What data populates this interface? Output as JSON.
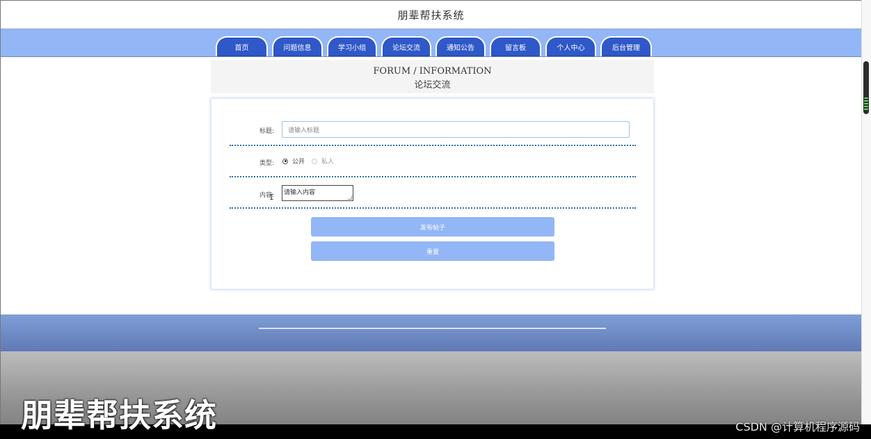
{
  "site": {
    "title": "朋辈帮扶系统"
  },
  "nav": {
    "tabs": [
      {
        "label": "首页"
      },
      {
        "label": "问题信息"
      },
      {
        "label": "学习小组"
      },
      {
        "label": "论坛交流"
      },
      {
        "label": "通知公告"
      },
      {
        "label": "留言板"
      },
      {
        "label": "个人中心"
      },
      {
        "label": "后台管理"
      }
    ]
  },
  "forum_header": {
    "title_en": "FORUM / INFORMATION",
    "title_cn": "论坛交流"
  },
  "form": {
    "title_label": "标题:",
    "title_placeholder": "请输入标题",
    "type_label": "类型:",
    "type_options": [
      {
        "label": "公开",
        "checked": true
      },
      {
        "label": "私人",
        "checked": false
      }
    ],
    "content_label": "内容:",
    "content_placeholder": "请输入内容",
    "submit_label": "发布帖子",
    "reset_label": "重置"
  },
  "overlay": {
    "caption": "朋辈帮扶系统",
    "watermark": "CSDN @计算机程序源码"
  },
  "colors": {
    "nav_band": "#93b6f7",
    "nav_tab": "#2f58c9",
    "button": "#93b6f7",
    "divider": "#2f6fb0",
    "footer": "#6f8fc8"
  },
  "icons": {
    "text_cursor": "text-cursor-icon",
    "resize_grip": "resize-grip-icon"
  }
}
